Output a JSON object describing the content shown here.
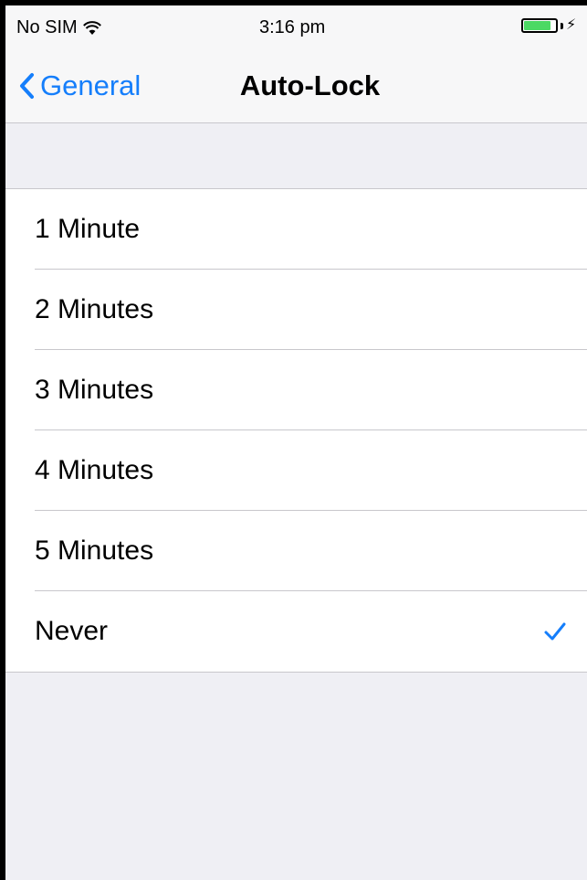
{
  "status_bar": {
    "carrier": "No SIM",
    "time": "3:16 pm",
    "battery_level": 0.9,
    "charging_icon": "bolt-icon"
  },
  "nav": {
    "back_label": "General",
    "title": "Auto-Lock"
  },
  "options": [
    {
      "label": "1 Minute",
      "selected": false
    },
    {
      "label": "2 Minutes",
      "selected": false
    },
    {
      "label": "3 Minutes",
      "selected": false
    },
    {
      "label": "4 Minutes",
      "selected": false
    },
    {
      "label": "5 Minutes",
      "selected": false
    },
    {
      "label": "Never",
      "selected": true
    }
  ],
  "colors": {
    "accent": "#157efb",
    "background": "#efeff4",
    "separator": "#c8c7cc",
    "battery": "#4cd964"
  }
}
